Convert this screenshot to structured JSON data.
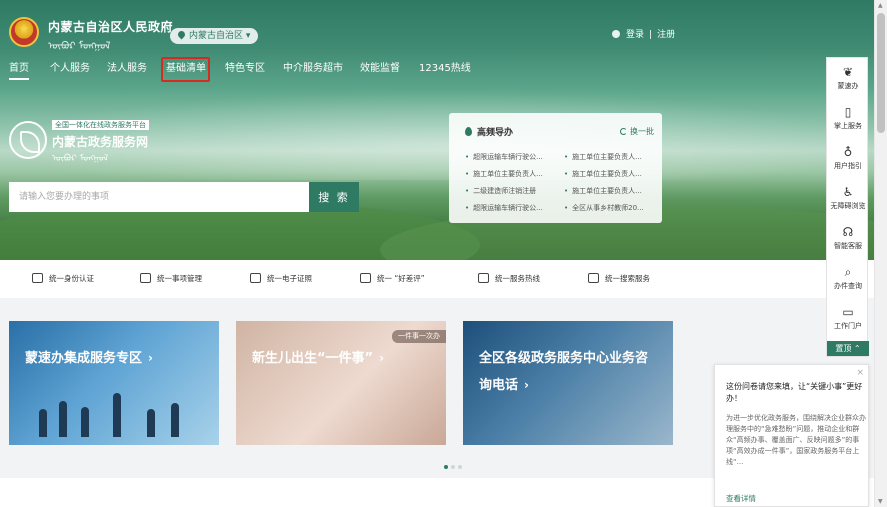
{
  "header": {
    "gov_name": "内蒙古自治区人民政府",
    "gov_mongol": "ᠥᠪᠦᠷ ᠮᠣᠩᠭᠣᠯ",
    "region_selector": "内蒙古自治区",
    "login": "登录",
    "separator": "|",
    "register": "注册"
  },
  "nav": {
    "items": [
      "首页",
      "个人服务",
      "法人服务",
      "基础清单",
      "特色专区",
      "中介服务超市",
      "效能监督",
      "12345热线"
    ]
  },
  "brand": {
    "tagline": "全国一体化在线政务服务平台",
    "title": "内蒙古政务服务网",
    "mongol": "ᠥᠪᠦᠷ ᠮᠣᠩᠭᠣᠯ"
  },
  "search": {
    "placeholder": "请输入您要办理的事项",
    "button": "搜 索"
  },
  "hot": {
    "title": "高频导办",
    "refresh": "换一批",
    "items": [
      "超限运输车辆行驶公...",
      "施工单位主要负责人...",
      "施工单位主要负责人...",
      "施工单位主要负责人...",
      "二级建造师注销注册",
      "施工单位主要负责人...",
      "超限运输车辆行驶公...",
      "全区从事乡村教师20..."
    ]
  },
  "services": {
    "items": [
      "统一身份认证",
      "统一事项管理",
      "统一电子证照",
      "统一 “好差评”",
      "统一服务热线",
      "统一搜索服务"
    ],
    "icons": [
      "user-icon",
      "list-icon",
      "license-icon",
      "rating-icon",
      "edit-icon",
      "search-list-icon"
    ]
  },
  "cards": [
    {
      "title": "蒙速办集成服务专区",
      "arrow": "›"
    },
    {
      "title": "新生儿出生“一件事”",
      "arrow": "›",
      "badge": "一件事一次办"
    },
    {
      "title": "全区各级政务服务中心业务咨询电话",
      "arrow": "›"
    }
  ],
  "carousel": {
    "total": 3,
    "active": 1
  },
  "rail": {
    "items": [
      "蒙速办",
      "掌上服务",
      "用户指引",
      "无障碍浏览",
      "智能客服",
      "办件查询",
      "工作门户"
    ],
    "icons": [
      "app-icon",
      "mobile-icon",
      "guide-icon",
      "accessibility-icon",
      "headset-icon",
      "query-icon",
      "portal-icon"
    ],
    "glyphs": [
      "❦",
      "▯",
      "♁",
      "♿",
      "☊",
      "⌕",
      "▭"
    ],
    "top": "置顶"
  },
  "survey": {
    "close": "×",
    "title": "这份问卷请您来填，让“关键小事”更好办！",
    "body": "为进一步优化政务服务，围绕解决企业群众办理服务中的“急难愁盼”问题，推动企业和群众“高频办事、覆盖面广、反映问题多”的事项“高效办成一件事”，国家政务服务平台上线“...",
    "link": "查看详情"
  },
  "colors": {
    "primary": "#2f7a63",
    "highlight": "#d62b1e"
  }
}
